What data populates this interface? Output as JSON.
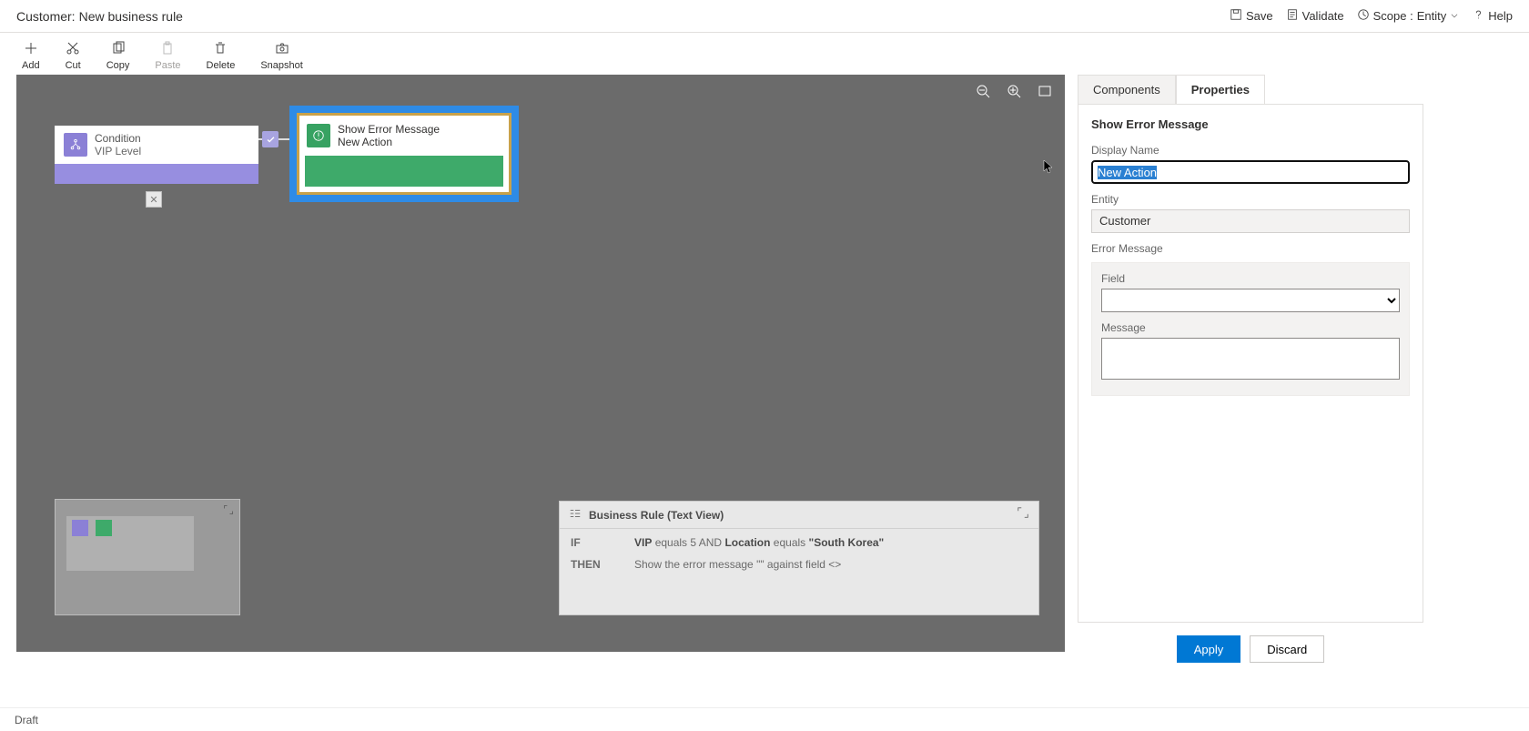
{
  "header": {
    "title_prefix": "Customer:",
    "title_name": "New business rule",
    "save_label": "Save",
    "validate_label": "Validate",
    "scope_label": "Scope :",
    "scope_value": "Entity",
    "help_label": "Help"
  },
  "toolbar": {
    "add": "Add",
    "cut": "Cut",
    "copy": "Copy",
    "paste": "Paste",
    "delete": "Delete",
    "snapshot": "Snapshot"
  },
  "canvas": {
    "condition": {
      "title": "Condition",
      "subtitle": "VIP Level"
    },
    "action": {
      "title": "Show Error Message",
      "subtitle": "New Action"
    }
  },
  "textview": {
    "title": "Business Rule (Text View)",
    "if_kw": "IF",
    "then_kw": "THEN",
    "cond_field1": "VIP",
    "cond_op1": "equals",
    "cond_val1": "5",
    "cond_and": "AND",
    "cond_field2": "Location",
    "cond_op2": "equals",
    "cond_val2": "\"South Korea\"",
    "then_text": "Show the error message \"\" against field <>"
  },
  "panel": {
    "tab_components": "Components",
    "tab_properties": "Properties",
    "heading": "Show Error Message",
    "display_name_label": "Display Name",
    "display_name_value": "New Action",
    "entity_label": "Entity",
    "entity_value": "Customer",
    "error_msg_label": "Error Message",
    "field_label": "Field",
    "message_label": "Message",
    "apply": "Apply",
    "discard": "Discard"
  },
  "status": "Draft"
}
